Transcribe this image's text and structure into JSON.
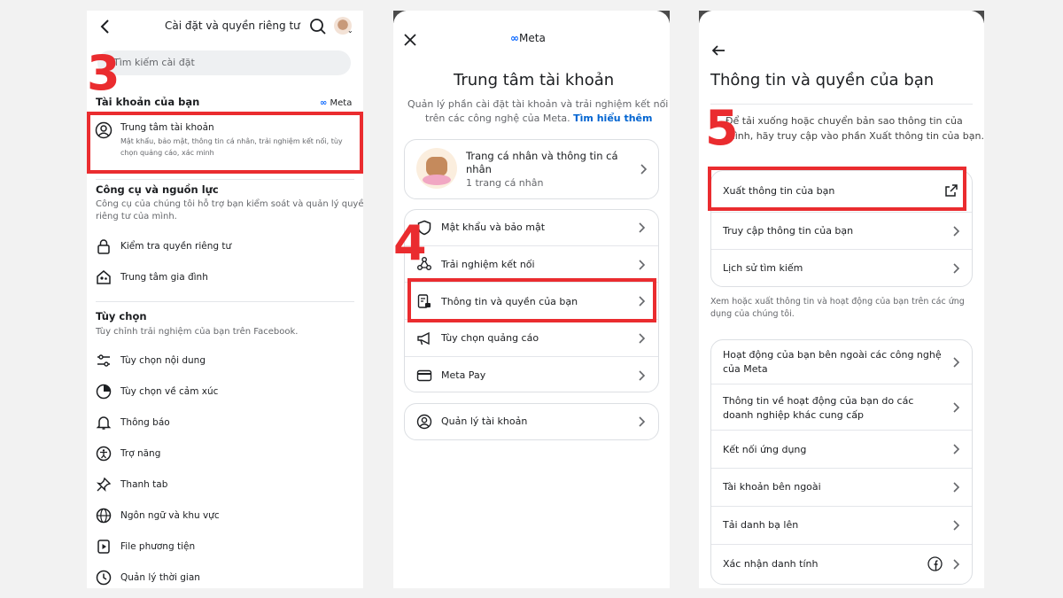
{
  "panel1": {
    "header_title": "Cài đặt và quyền riêng tư",
    "search_placeholder": "Tìm kiếm cài đặt",
    "step": "3",
    "section_account": "Tài khoản của bạn",
    "meta_logo": "Meta",
    "account_center_title": "Trung tâm tài khoản",
    "account_center_desc_1": "Mật khẩu, bảo mật, thông tin cá nhân, trải nghiệm kết nối, tùy",
    "account_center_desc_2": "chọn quảng cáo, xác minh",
    "section_tools": "Công cụ và nguồn lực",
    "tools_desc_1": "Công cụ của chúng tôi hỗ trợ bạn kiểm soát và quản lý quyền",
    "tools_desc_2": "riêng tư của mình.",
    "tools_items": [
      "Kiểm tra quyền riêng tư",
      "Trung tâm gia đình"
    ],
    "section_prefs": "Tùy chọn",
    "prefs_desc": "Tùy chỉnh trải nghiệm của bạn trên Facebook.",
    "prefs_items": [
      "Tùy chọn nội dung",
      "Tùy chọn về cảm xúc",
      "Thông báo",
      "Trợ năng",
      "Thanh tab",
      "Ngôn ngữ và khu vực",
      "File phương tiện",
      "Quản lý thời gian"
    ]
  },
  "panel2": {
    "meta_logo": "Meta",
    "title": "Trung tâm tài khoản",
    "desc_1": "Quản lý phần cài đặt tài khoản và trải nghiệm kết nối",
    "desc_2": "trên các công nghệ của Meta.",
    "learn_more": "Tìm hiểu thêm",
    "profile_title_1": "Trang cá nhân và thông tin cá",
    "profile_title_2": "nhân",
    "profile_sub": "1 trang cá nhân",
    "step": "4",
    "menu_items": [
      "Mật khẩu và bảo mật",
      "Trải nghiệm kết nối",
      "Thông tin và quyền của bạn",
      "Tùy chọn quảng cáo",
      "Meta Pay"
    ],
    "manage_accounts": "Quản lý tài khoản"
  },
  "panel3": {
    "title": "Thông tin và quyền của bạn",
    "step": "5",
    "desc_1": "Để tải xuống hoặc chuyển bản sao thông tin của",
    "desc_2": "mình, hãy truy cập vào phần Xuất thông tin của bạn.",
    "group1": [
      "Xuất thông tin của bạn",
      "Truy cập thông tin của bạn",
      "Lịch sử tìm kiếm"
    ],
    "desc2_1": "Xem hoặc xuất thông tin và hoạt động của bạn trên các ứng",
    "desc2_2": "dụng của chúng tôi.",
    "group2_item1_l1": "Hoạt động của bạn bên ngoài các công nghệ",
    "group2_item1_l2": "của Meta",
    "group2_item2_l1": "Thông tin về hoạt động của bạn do các",
    "group2_item2_l2": "doanh nghiệp khác cung cấp",
    "group2_rest": [
      "Kết nối ứng dụng",
      "Tài khoản bên ngoài",
      "Tải danh bạ lên",
      "Xác nhận danh tính"
    ]
  },
  "colors": {
    "highlight": "#ea2c2f",
    "link": "#0064d1",
    "meta_blue": "#0866ff"
  }
}
